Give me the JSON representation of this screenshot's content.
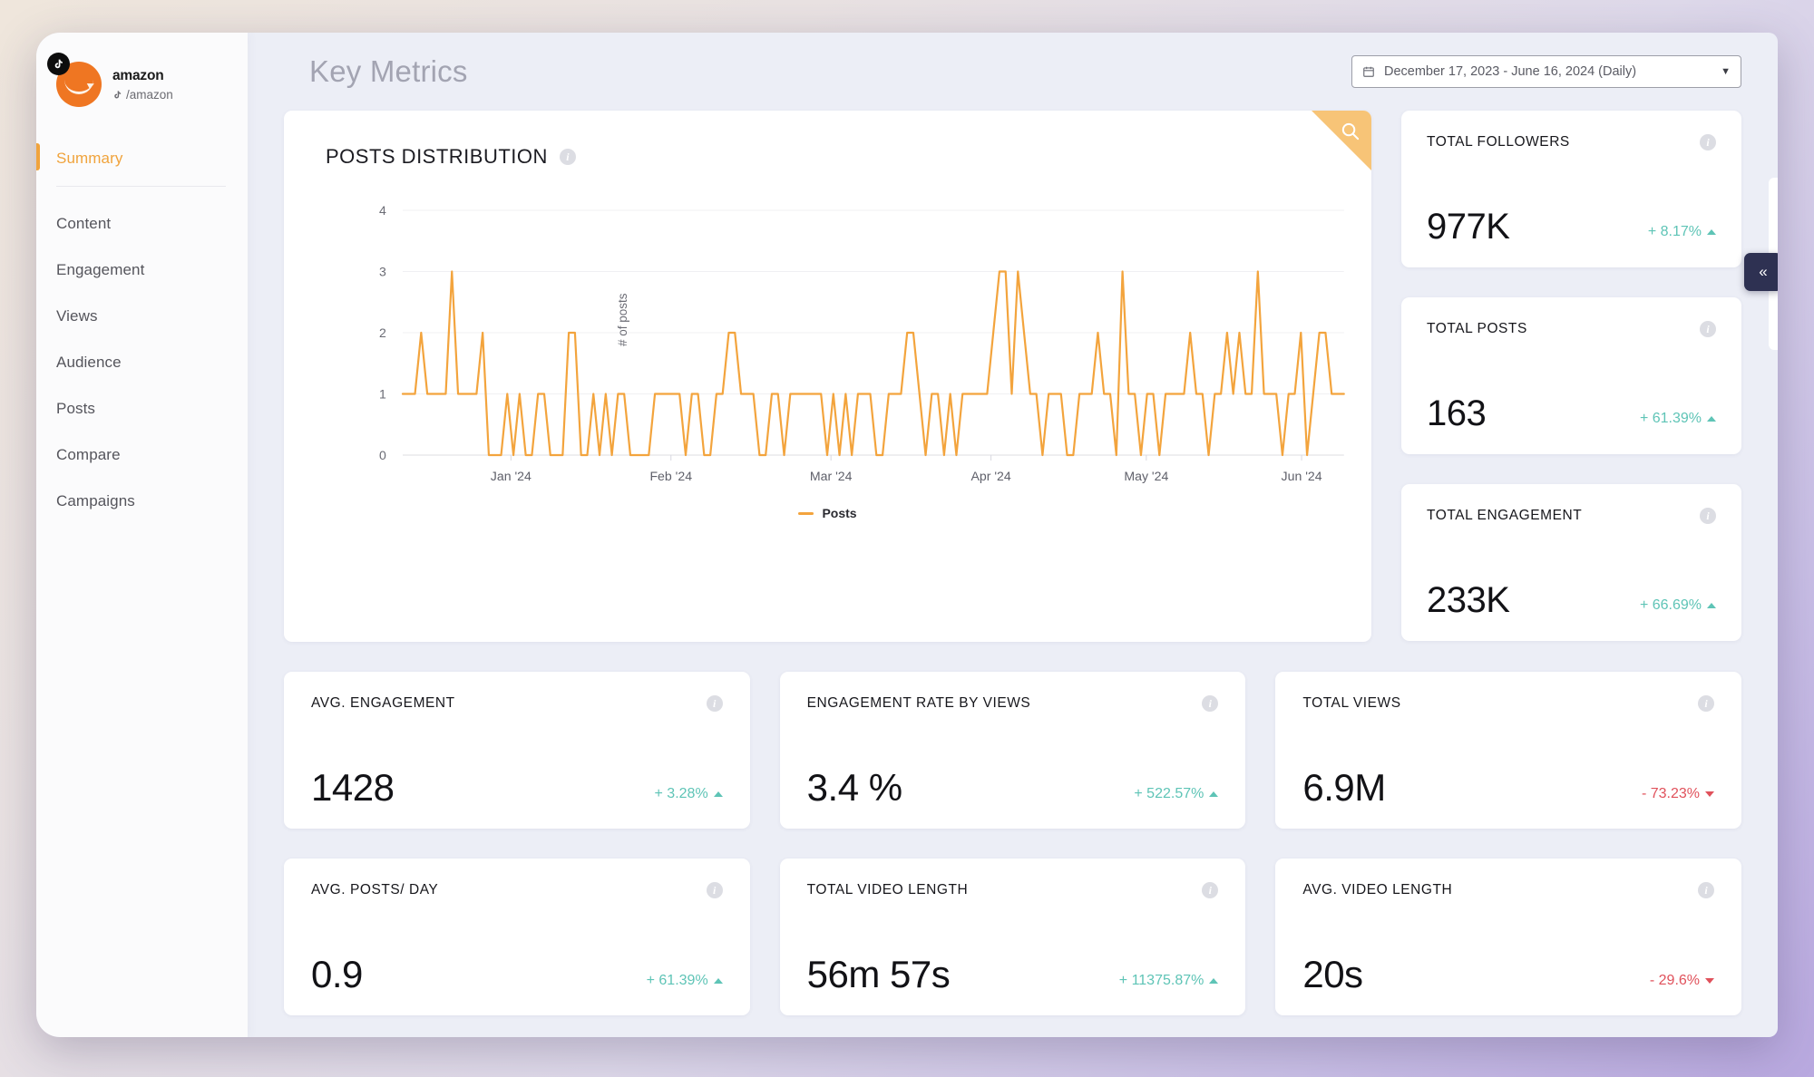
{
  "brand": {
    "accent": "#f0a33c",
    "positive": "#5ec4b6",
    "negative": "#e0515b",
    "line": "#f3a43d"
  },
  "sidebar": {
    "profile": {
      "name": "amazon",
      "handle": "/amazon",
      "platform_icon": "tiktok-icon",
      "avatar_icon": "amazon-avatar"
    },
    "items": [
      {
        "label": "Summary",
        "active": true
      },
      {
        "label": "Content",
        "active": false
      },
      {
        "label": "Engagement",
        "active": false
      },
      {
        "label": "Views",
        "active": false
      },
      {
        "label": "Audience",
        "active": false
      },
      {
        "label": "Posts",
        "active": false
      },
      {
        "label": "Compare",
        "active": false
      },
      {
        "label": "Campaigns",
        "active": false
      }
    ]
  },
  "header": {
    "title": "Key Metrics",
    "date_range": "December 17, 2023 - June 16, 2024 (Daily)",
    "calendar_icon": "calendar-icon",
    "caret": "▼"
  },
  "chart_card": {
    "title": "POSTS DISTRIBUTION",
    "info_icon": "info-icon",
    "search_icon": "search-icon"
  },
  "chart_data": {
    "type": "line",
    "title": "POSTS DISTRIBUTION",
    "xlabel": "",
    "ylabel": "# of posts",
    "ylim": [
      0,
      4
    ],
    "yticks": [
      0,
      1,
      2,
      3,
      4
    ],
    "xticks": [
      "Jan '24",
      "Feb '24",
      "Mar '24",
      "Apr '24",
      "May '24",
      "Jun '24"
    ],
    "xtick_positions": [
      0.115,
      0.285,
      0.455,
      0.625,
      0.79,
      0.955
    ],
    "grid": true,
    "legend": {
      "position": "bottom",
      "entries": [
        "Posts"
      ]
    },
    "series": [
      {
        "name": "Posts",
        "color": "#f3a43d",
        "values": [
          1,
          1,
          1,
          2,
          1,
          1,
          1,
          1,
          3,
          1,
          1,
          1,
          1,
          2,
          0,
          0,
          0,
          1,
          0,
          1,
          0,
          0,
          1,
          1,
          0,
          0,
          0,
          2,
          2,
          0,
          0,
          1,
          0,
          1,
          0,
          1,
          1,
          0,
          0,
          0,
          0,
          1,
          1,
          1,
          1,
          1,
          0,
          1,
          1,
          0,
          0,
          1,
          1,
          2,
          2,
          1,
          1,
          1,
          0,
          0,
          1,
          1,
          0,
          1,
          1,
          1,
          1,
          1,
          1,
          0,
          1,
          0,
          1,
          0,
          1,
          1,
          1,
          0,
          0,
          1,
          1,
          1,
          2,
          2,
          1,
          0,
          1,
          1,
          0,
          1,
          0,
          1,
          1,
          1,
          1,
          1,
          2,
          3,
          3,
          1,
          3,
          2,
          1,
          1,
          0,
          1,
          1,
          1,
          0,
          0,
          1,
          1,
          1,
          2,
          1,
          1,
          0,
          3,
          1,
          1,
          0,
          1,
          1,
          0,
          1,
          1,
          1,
          1,
          2,
          1,
          1,
          0,
          1,
          1,
          2,
          1,
          2,
          1,
          1,
          3,
          1,
          1,
          1,
          0,
          1,
          1,
          2,
          0,
          1,
          2,
          2,
          1,
          1,
          1
        ]
      }
    ]
  },
  "kpis_right": [
    {
      "label": "TOTAL FOLLOWERS",
      "value": "977K",
      "delta": "+ 8.17%",
      "direction": "up",
      "info_icon": "info-icon"
    },
    {
      "label": "TOTAL POSTS",
      "value": "163",
      "delta": "+ 61.39%",
      "direction": "up",
      "info_icon": "info-icon"
    },
    {
      "label": "TOTAL ENGAGEMENT",
      "value": "233K",
      "delta": "+ 66.69%",
      "direction": "up",
      "info_icon": "info-icon"
    }
  ],
  "kpis_row1": [
    {
      "label": "AVG. ENGAGEMENT",
      "value": "1428",
      "delta": "+ 3.28%",
      "direction": "up",
      "info_icon": "info-icon"
    },
    {
      "label": "ENGAGEMENT RATE BY VIEWS",
      "value": "3.4 %",
      "delta": "+ 522.57%",
      "direction": "up",
      "info_icon": "info-icon"
    },
    {
      "label": "TOTAL VIEWS",
      "value": "6.9M",
      "delta": "- 73.23%",
      "direction": "down",
      "info_icon": "info-icon"
    }
  ],
  "kpis_row2": [
    {
      "label": "AVG. POSTS/ DAY",
      "value": "0.9",
      "delta": "+ 61.39%",
      "direction": "up",
      "info_icon": "info-icon"
    },
    {
      "label": "TOTAL VIDEO LENGTH",
      "value": "56m 57s",
      "delta": "+ 11375.87%",
      "direction": "up",
      "info_icon": "info-icon"
    },
    {
      "label": "AVG. VIDEO LENGTH",
      "value": "20s",
      "delta": "- 29.6%",
      "direction": "down",
      "info_icon": "info-icon"
    }
  ],
  "collapse_button": {
    "label": "«",
    "icon": "chevron-double-left-icon"
  }
}
